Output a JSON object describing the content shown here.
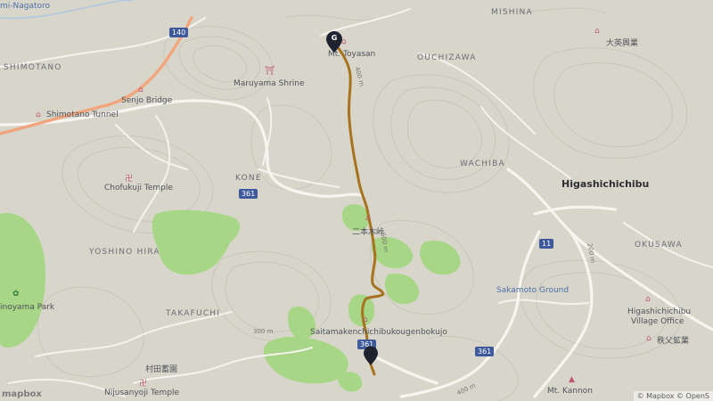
{
  "map": {
    "places": {
      "mi_nagatoro": "mi-Nagatoro",
      "shimotano": "SHIMOTANO",
      "mishina": "MISHINA",
      "ouchizawa": "OUCHIZAWA",
      "wachiba": "WACHIBA",
      "kone": "KONE",
      "yoshino_hira": "YOSHINO HIRA",
      "takafuchi": "TAKAFUCHI",
      "okusawa": "OKUSAWA",
      "higashichichibu": "Higashichichibu"
    },
    "pois": {
      "mt_toyasan": "Mt. Toyasan",
      "maruyama_shrine": "Maruyama Shrine",
      "senjo_bridge": "Senjo Bridge",
      "shimotano_tunnel": "Shimotano Tunnel",
      "chofukuji_temple": "Chofukuji Temple",
      "nihongi_pass": "二本木峠",
      "saitama_farm": "Saitamakenchichibukougenbokujo",
      "sakamoto_ground": "Sakamoto Ground",
      "village_office_line1": "Higashichichibu",
      "village_office_line2": "Village Office",
      "chichibu_mining": "秩父鉱業",
      "mt_kannon": "Mt. Kannon",
      "murata": "村田蓄園",
      "nijusanyoji_temple": "Nijusanyoji Temple",
      "minoyama_park": "inoyama Park",
      "daiei": "大英興業"
    },
    "roads": {
      "r140": "140",
      "r361_a": "361",
      "r361_b": "361",
      "r361_c": "361",
      "r11": "11"
    },
    "contours": {
      "c400": "400 m",
      "c300": "300 m",
      "c200": "200 m",
      "c600": "600 m",
      "c400b": "400 m"
    },
    "markers": {
      "goal": "G"
    },
    "attribution": "© Mapbox © OpenS",
    "logo": "mapbox",
    "colors": {
      "terrain": "#d8d6cb",
      "forest": "#9fd67a",
      "route": "#a7731f",
      "highway": "#f2a57c",
      "road": "#f4f3ee",
      "marker": "#1f2330"
    }
  }
}
